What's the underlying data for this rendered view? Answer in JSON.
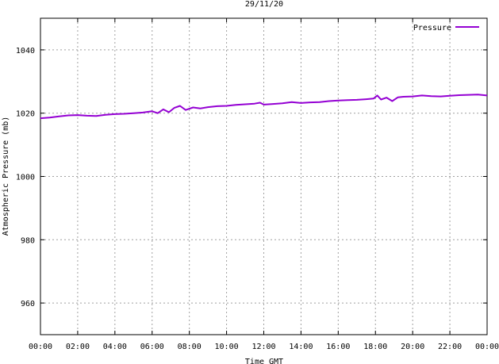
{
  "chart_data": {
    "type": "line",
    "title": "29/11/20",
    "xlabel": "Time GMT",
    "ylabel": "Atmospheric Pressure (mb)",
    "xlim": [
      0,
      24
    ],
    "ylim": [
      950,
      1050
    ],
    "x_ticks": [
      {
        "value": 0,
        "label": "00:00"
      },
      {
        "value": 2,
        "label": "02:00"
      },
      {
        "value": 4,
        "label": "04:00"
      },
      {
        "value": 6,
        "label": "06:00"
      },
      {
        "value": 8,
        "label": "08:00"
      },
      {
        "value": 10,
        "label": "10:00"
      },
      {
        "value": 12,
        "label": "12:00"
      },
      {
        "value": 14,
        "label": "14:00"
      },
      {
        "value": 16,
        "label": "16:00"
      },
      {
        "value": 18,
        "label": "18:00"
      },
      {
        "value": 20,
        "label": "20:00"
      },
      {
        "value": 22,
        "label": "22:00"
      },
      {
        "value": 24,
        "label": "00:00"
      }
    ],
    "y_ticks": [
      {
        "value": 960,
        "label": "960"
      },
      {
        "value": 980,
        "label": "980"
      },
      {
        "value": 1000,
        "label": "1000"
      },
      {
        "value": 1020,
        "label": "1020"
      },
      {
        "value": 1040,
        "label": "1040"
      }
    ],
    "grid": true,
    "legend_position": "top-right",
    "series": [
      {
        "name": "Pressure",
        "color": "#9400d3",
        "x": [
          0,
          0.5,
          1,
          1.5,
          2,
          2.5,
          3,
          3.5,
          4,
          4.5,
          5,
          5.5,
          6,
          6.3,
          6.6,
          6.9,
          7.2,
          7.5,
          7.8,
          8.2,
          8.6,
          9,
          9.5,
          10,
          10.5,
          11,
          11.5,
          11.8,
          12,
          12.5,
          13,
          13.5,
          14,
          14.5,
          15,
          15.5,
          16,
          16.5,
          17,
          17.5,
          17.9,
          18.1,
          18.3,
          18.6,
          18.9,
          19.2,
          19.5,
          20,
          20.5,
          21,
          21.5,
          22,
          22.5,
          23,
          23.5,
          24
        ],
        "values": [
          1018.4,
          1018.6,
          1019.0,
          1019.3,
          1019.4,
          1019.2,
          1019.1,
          1019.5,
          1019.7,
          1019.8,
          1020.0,
          1020.2,
          1020.6,
          1020.0,
          1021.2,
          1020.3,
          1021.7,
          1022.3,
          1021.0,
          1021.8,
          1021.5,
          1021.9,
          1022.2,
          1022.3,
          1022.6,
          1022.8,
          1023.0,
          1023.3,
          1022.7,
          1022.9,
          1023.1,
          1023.5,
          1023.2,
          1023.4,
          1023.5,
          1023.8,
          1024.0,
          1024.1,
          1024.2,
          1024.4,
          1024.6,
          1025.6,
          1024.3,
          1024.9,
          1023.8,
          1025.0,
          1025.2,
          1025.3,
          1025.6,
          1025.4,
          1025.3,
          1025.5,
          1025.7,
          1025.8,
          1025.9,
          1025.6
        ]
      }
    ]
  }
}
